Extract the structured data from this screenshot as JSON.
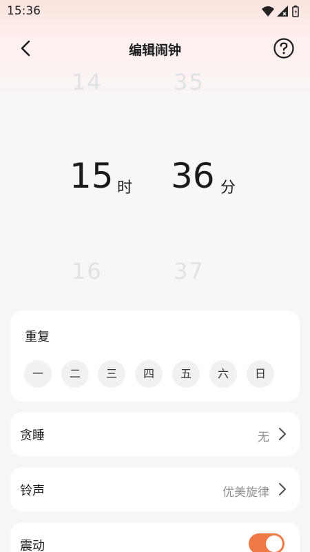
{
  "status": {
    "time": "15:36",
    "icons": [
      "wifi-icon",
      "signal-icon",
      "battery-icon"
    ]
  },
  "header": {
    "title": "编辑闹钟",
    "back_icon": "back-arrow-icon",
    "help_icon": "help-icon"
  },
  "picker": {
    "hour_prev": "14",
    "hour": "15",
    "hour_next": "16",
    "hour_unit": "时",
    "minute_prev": "35",
    "minute": "36",
    "minute_next": "37",
    "minute_unit": "分"
  },
  "repeat": {
    "title": "重复",
    "days": [
      "一",
      "二",
      "三",
      "四",
      "五",
      "六",
      "日"
    ]
  },
  "snooze": {
    "label": "贪睡",
    "value": "无"
  },
  "ringtone": {
    "label": "铃声",
    "value": "优美旋律"
  },
  "vibrate": {
    "label": "震动",
    "enabled": true
  },
  "colors": {
    "accent": "#f07a45",
    "background": "#f6f6f6",
    "card": "#ffffff"
  }
}
